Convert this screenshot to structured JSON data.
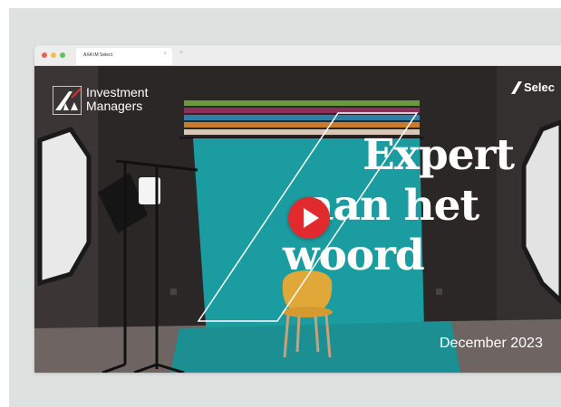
{
  "browser": {
    "tab_title": "AXA IM Select",
    "tab_close": "×",
    "new_tab": "+"
  },
  "hero": {
    "brand": {
      "line1": "Investment",
      "line2": "Managers"
    },
    "select_label": "Selec",
    "headline": [
      "Expert",
      "aan het",
      "woord"
    ],
    "date": "December 2023"
  },
  "colors": {
    "backdrop_teal": "#1a9ca0",
    "play_red": "#e02a2d",
    "axa_blue": "#00008f"
  }
}
